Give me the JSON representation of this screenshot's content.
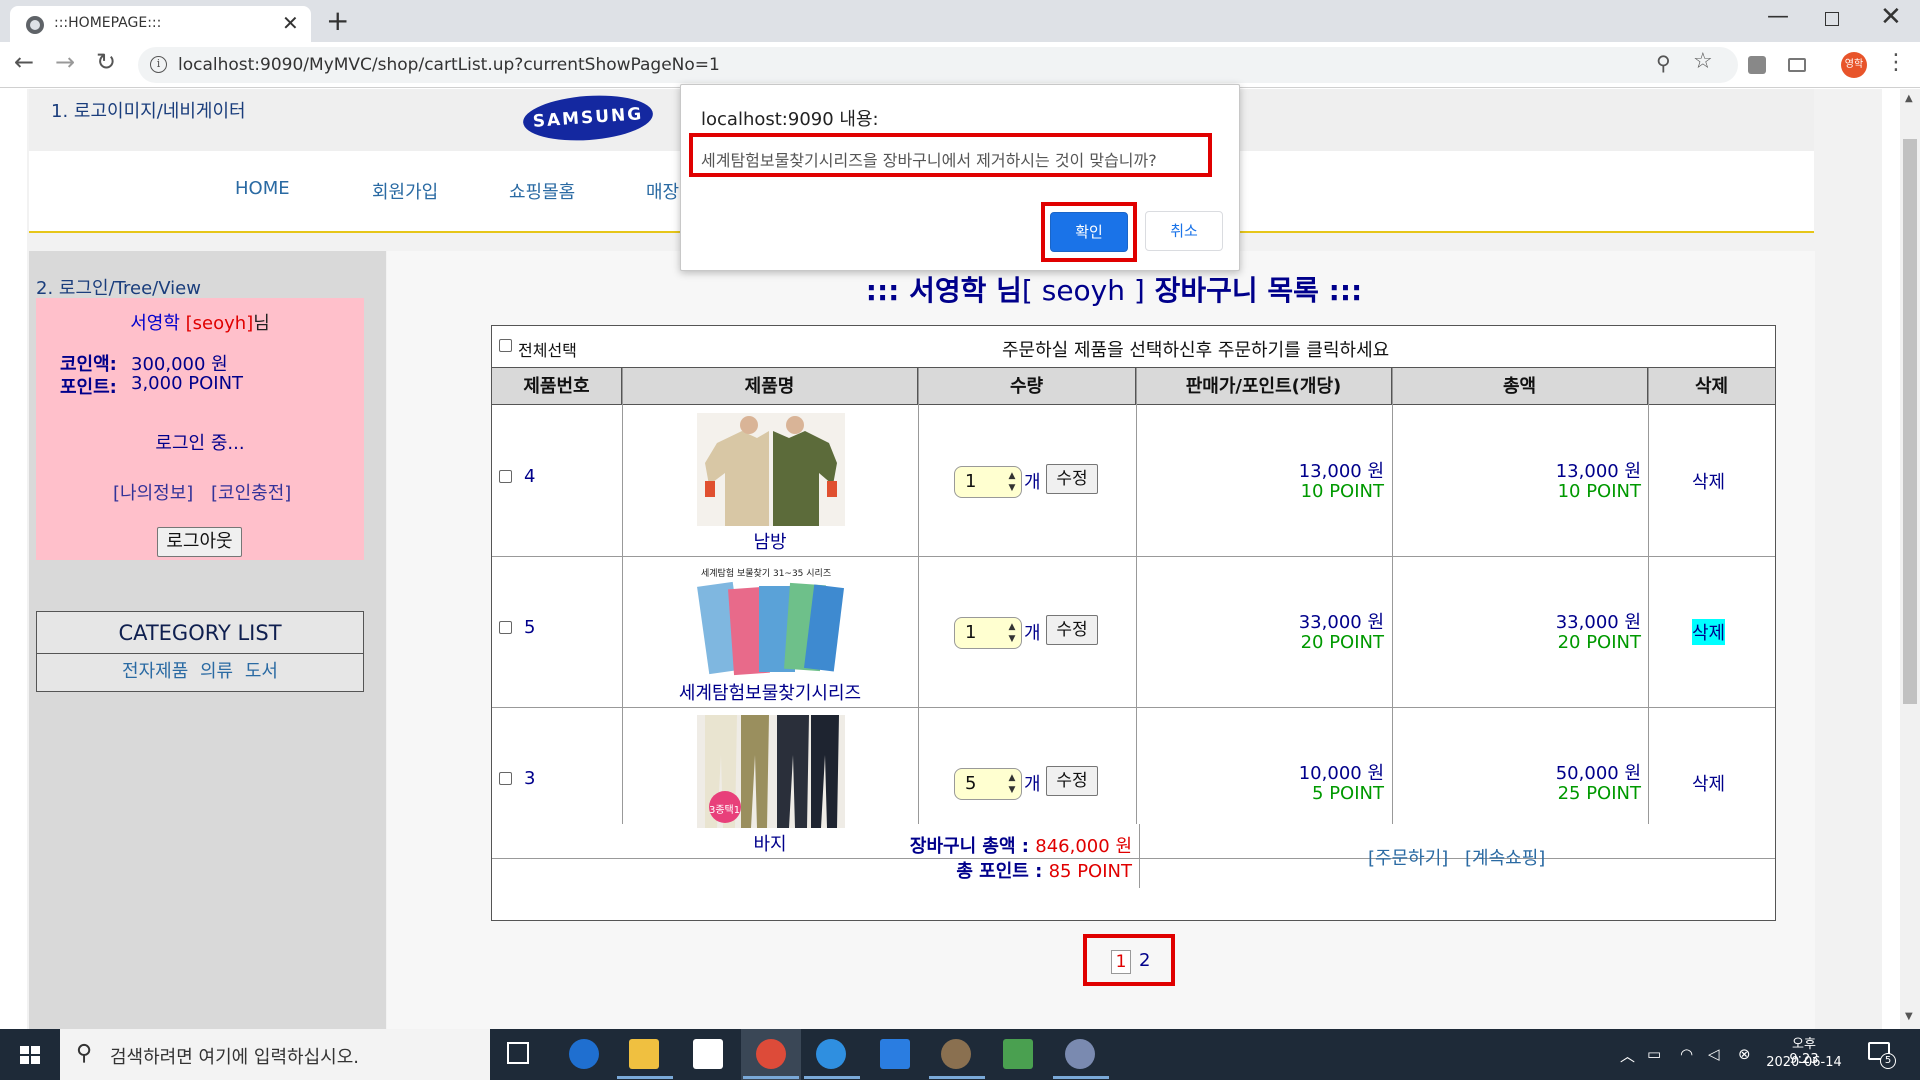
{
  "browser": {
    "tab_title": ":::HOMEPAGE:::",
    "url": "localhost:9090/MyMVC/shop/cartList.up?currentShowPageNo=1",
    "profile_initial": "영학"
  },
  "header": {
    "label": "1. 로고이미지/네비게이터",
    "logo_text": "SAMSUNG"
  },
  "nav": {
    "items": [
      "HOME",
      "회원가입",
      "쇼핑몰홈",
      "매장"
    ]
  },
  "login": {
    "section_label": "2. 로그인/Tree/View",
    "name": "서영학",
    "id_display": "[seoyh]",
    "suffix": "님",
    "coin_label": "코인액:",
    "coin_value": "300,000 원",
    "point_label": "포인트:",
    "point_value": "3,000 POINT",
    "status": "로그인 중...",
    "my_info": "[나의정보]",
    "coin_charge": "[코인충전]",
    "logout": "로그아웃"
  },
  "category": {
    "title": "CATEGORY LIST",
    "items": [
      "전자제품",
      "의류",
      "도서"
    ]
  },
  "cart": {
    "title_prefix": "::: 서영학 님",
    "title_id": "[ seoyh ]",
    "title_suffix": "장바구니 목록 :::",
    "select_all": "전체선택",
    "instruction": "주문하실 제품을 선택하신후 주문하기를 클릭하세요",
    "columns": [
      "제품번호",
      "제품명",
      "수량",
      "판매가/포인트(개당)",
      "총액",
      "삭제"
    ],
    "qty_unit": "개",
    "edit_label": "수정",
    "rows": [
      {
        "no": "4",
        "name": "남방",
        "qty": "1",
        "unit_price": "13,000 원",
        "unit_point": "10 POINT",
        "total_price": "13,000 원",
        "total_point": "10 POINT",
        "delete": "삭제"
      },
      {
        "no": "5",
        "name": "세계탐험보물찾기시리즈",
        "qty": "1",
        "unit_price": "33,000 원",
        "unit_point": "20 POINT",
        "total_price": "33,000 원",
        "total_point": "20 POINT",
        "delete": "삭제"
      },
      {
        "no": "3",
        "name": "바지",
        "qty": "5",
        "unit_price": "10,000 원",
        "unit_point": "5 POINT",
        "total_price": "50,000 원",
        "total_point": "25 POINT",
        "delete": "삭제"
      }
    ],
    "sum_total_label": "장바구니 총액 :",
    "sum_total_value": "846,000 원",
    "sum_point_label": "총 포인트 :",
    "sum_point_value": "85 POINT",
    "order": "[주문하기]",
    "continue": "[계속쇼핑]",
    "book_cover_text": "세계탐험 보물찾기 31~35 시리즈",
    "pants_badge": "3종택1"
  },
  "pagination": {
    "current": "1",
    "next": "2"
  },
  "dialog": {
    "title": "localhost:9090 내용:",
    "message": "세계탐험보물찾기시리즈을 장바구니에서 제거하시는 것이 맞습니까?",
    "ok": "확인",
    "cancel": "취소"
  },
  "taskbar": {
    "search_placeholder": "검색하려면 여기에 입력하십시오.",
    "time": "오후 9:23",
    "date": "2020-06-14",
    "notification_count": "5"
  }
}
